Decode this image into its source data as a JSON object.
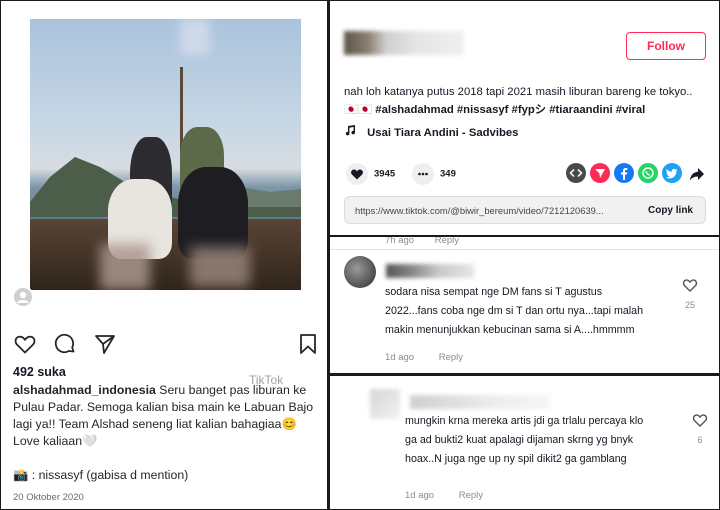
{
  "instagram": {
    "likes": "492 suka",
    "username": "alshadahmad_indonesia",
    "caption": "Seru banget pas liburan ke Pulau Padar. Semoga kalian bisa main ke Labuan Bajo lagi ya!! Team Alshad seneng liat kalian bahagiaa😊 Love kaliaan🤍",
    "tagged": ": nissasyf (gabisa d mention)",
    "date": "20 Oktober 2020",
    "watermark": "TikTok"
  },
  "tiktok": {
    "follow_label": "Follow",
    "description": "nah loh katanya putus 2018 tapi 2021 masih liburan bareng ke tokyo.. 🇯🇵🇯🇵",
    "hashtags": "#alshadahmad #nissasyf #fypシ #tiaraandini #viral",
    "music": "Usai Tiara Andini - Sadvibes",
    "likes_count": "3945",
    "comments_count": "349",
    "share_url": "https://www.tiktok.com/@biwir_bereum/video/7212120639...",
    "copy_link_label": "Copy link",
    "share_icons": [
      "embed-icon",
      "send-icon",
      "facebook-icon",
      "whatsapp-icon",
      "twitter-icon",
      "share-arrow-icon"
    ],
    "colors": {
      "accent": "#fe2c55",
      "facebook": "#1877f2",
      "whatsapp": "#25d366",
      "twitter": "#1da1f2",
      "send": "#fe2c55"
    }
  },
  "comments": [
    {
      "text": "sodara nisa sempat nge DM fans si T agustus 2022...fans coba nge dm si T dan ortu nya...tapi malah makin menunjukkan kebucinan sama si A....hmmmm",
      "age": "1d ago",
      "reply_label": "Reply",
      "likes": "25"
    },
    {
      "text": "mungkin krna mereka artis jdi ga trlalu percaya klo ga ad bukti2 kuat apalagi dijaman skrng yg bnyk hoax..N juga nge up ny spil dikit2 ga gamblang",
      "age": "1d ago",
      "reply_label": "Reply",
      "likes": "6"
    }
  ],
  "previous_comment_meta": {
    "age": "7h ago",
    "reply_label": "Reply"
  }
}
